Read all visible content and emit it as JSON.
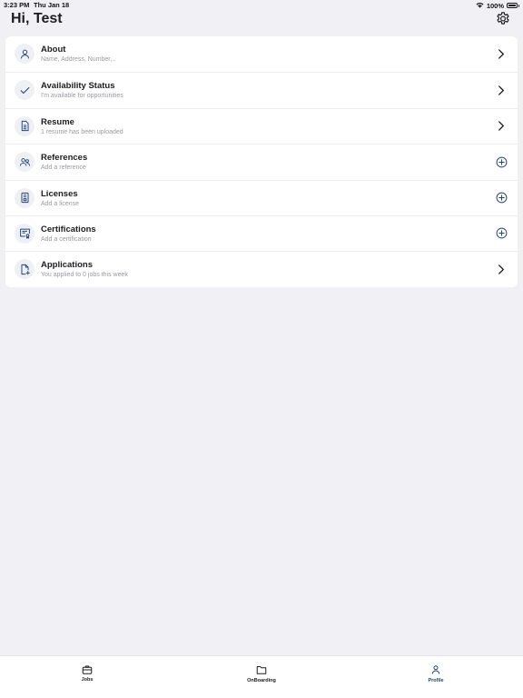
{
  "status_bar": {
    "time": "3:23 PM",
    "date": "Thu Jan 18",
    "battery": "100%",
    "wifi_icon": "wifi-icon",
    "battery_icon": "battery-full-icon"
  },
  "header": {
    "greeting": "Hi, Test",
    "settings_icon": "gear-icon"
  },
  "profile_menu": {
    "items": [
      {
        "title": "About",
        "subtitle": "Name, Address, Number,..",
        "icon": "person-icon",
        "action": "chevron-right-icon"
      },
      {
        "title": "Availability Status",
        "subtitle": "I'm available for opportunities",
        "icon": "checkmark-icon",
        "action": "chevron-right-icon"
      },
      {
        "title": "Resume",
        "subtitle": "1 resume has been uploaded",
        "icon": "document-icon",
        "action": "chevron-right-icon"
      },
      {
        "title": "References",
        "subtitle": "Add a reference",
        "icon": "people-icon",
        "action": "plus-circle-icon"
      },
      {
        "title": "Licenses",
        "subtitle": "Add a license",
        "icon": "license-icon",
        "action": "plus-circle-icon"
      },
      {
        "title": "Certifications",
        "subtitle": "Add a certification",
        "icon": "certificate-icon",
        "action": "plus-circle-icon"
      },
      {
        "title": "Applications",
        "subtitle": "You applied to 0 jobs this week",
        "icon": "file-add-icon",
        "action": "chevron-right-icon"
      }
    ]
  },
  "tab_bar": {
    "tabs": [
      {
        "label": "Jobs",
        "icon": "briefcase-icon",
        "active": false
      },
      {
        "label": "OnBoarding",
        "icon": "folder-icon",
        "active": false
      },
      {
        "label": "Profile",
        "icon": "person-icon",
        "active": true
      }
    ]
  },
  "colors": {
    "background": "#f1f1f5",
    "card": "#ffffff",
    "accent": "#21467a",
    "icon_bubble": "#eef0f4",
    "subtitle_text": "#9a9aa2"
  }
}
